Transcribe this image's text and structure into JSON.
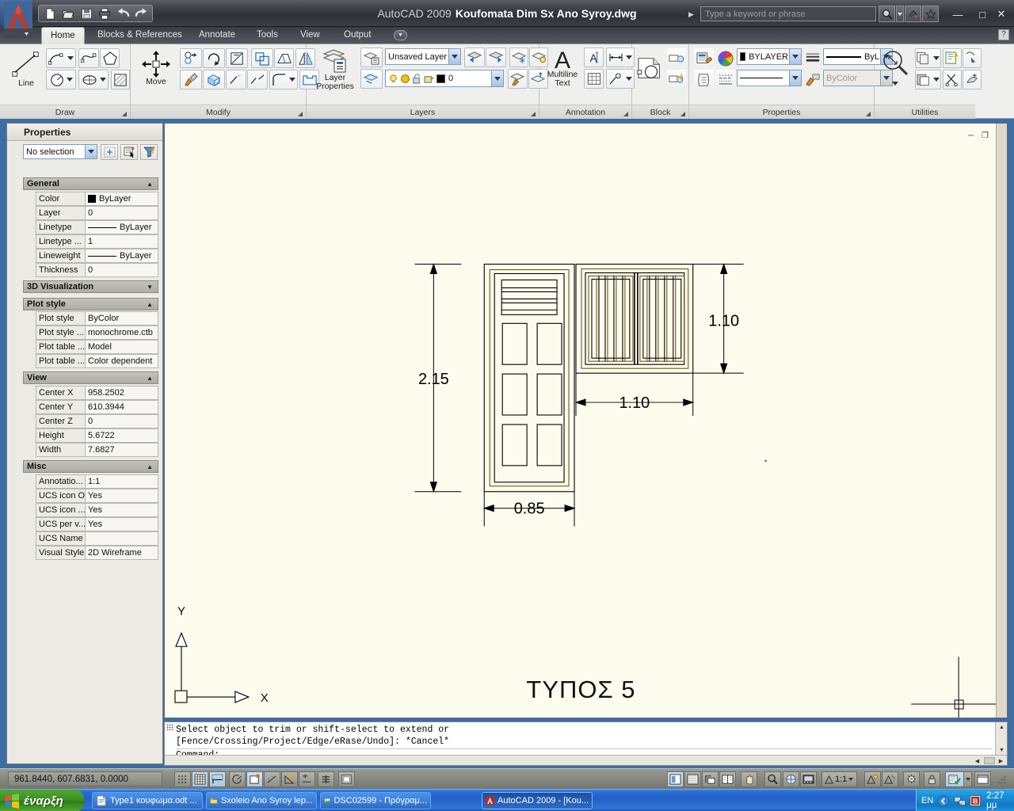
{
  "titlebar": {
    "app_name": "AutoCAD 2009",
    "document": "Koufomata Dim Sx Ano Syroy.dwg",
    "search_placeholder": "Type a keyword or phrase",
    "qat": [
      "new-icon",
      "open-icon",
      "save-icon",
      "plot-icon",
      "undo-icon",
      "redo-icon"
    ],
    "minimize": "—",
    "maximize": "□",
    "close": "✕",
    "help_label": "?"
  },
  "ribbon": {
    "tabs": [
      {
        "label": "Home",
        "active": true
      },
      {
        "label": "Blocks & References",
        "active": false
      },
      {
        "label": "Annotate",
        "active": false
      },
      {
        "label": "Tools",
        "active": false
      },
      {
        "label": "View",
        "active": false
      },
      {
        "label": "Output",
        "active": false
      }
    ],
    "panels": [
      {
        "label": "Draw",
        "big_button": "Line"
      },
      {
        "label": "Modify",
        "big_button": "Move"
      },
      {
        "label": "Layers",
        "big_button": "Layer\nProperties"
      },
      {
        "label": "Annotation",
        "big_button": "Multiline\nText"
      },
      {
        "label": "Block",
        "big_button": ""
      },
      {
        "label": "Properties",
        "big_button": ""
      },
      {
        "label": "Utilities",
        "big_button": ""
      }
    ],
    "layer_state": "Unsaved Layer S",
    "layer_current": "0",
    "prop_color": "BYLAYER",
    "prop_lineweight": "ByL",
    "prop_plotstyle": "ByColor"
  },
  "properties_palette": {
    "title": "Properties",
    "selection": "No selection",
    "groups": [
      {
        "name": "General",
        "expanded": true,
        "rows": [
          {
            "key": "Color",
            "value": "ByLayer",
            "swatch": true
          },
          {
            "key": "Layer",
            "value": "0"
          },
          {
            "key": "Linetype",
            "value": "ByLayer",
            "line": true
          },
          {
            "key": "Linetype ...",
            "value": "1"
          },
          {
            "key": "Lineweight",
            "value": "ByLayer",
            "line": true
          },
          {
            "key": "Thickness",
            "value": "0"
          }
        ]
      },
      {
        "name": "3D Visualization",
        "expanded": false,
        "rows": []
      },
      {
        "name": "Plot style",
        "expanded": true,
        "rows": [
          {
            "key": "Plot style",
            "value": "ByColor"
          },
          {
            "key": "Plot style ...",
            "value": "monochrome.ctb"
          },
          {
            "key": "Plot table ...",
            "value": "Model"
          },
          {
            "key": "Plot table ...",
            "value": "Color dependent"
          }
        ]
      },
      {
        "name": "View",
        "expanded": true,
        "rows": [
          {
            "key": "Center X",
            "value": "958.2502"
          },
          {
            "key": "Center Y",
            "value": "610.3944"
          },
          {
            "key": "Center Z",
            "value": "0"
          },
          {
            "key": "Height",
            "value": "5.6722"
          },
          {
            "key": "Width",
            "value": "7.6827"
          }
        ]
      },
      {
        "name": "Misc",
        "expanded": true,
        "rows": [
          {
            "key": "Annotatio...",
            "value": "1:1"
          },
          {
            "key": "UCS icon On",
            "value": "Yes"
          },
          {
            "key": "UCS icon ...",
            "value": "Yes"
          },
          {
            "key": "UCS per v...",
            "value": "Yes"
          },
          {
            "key": "UCS Name",
            "value": ""
          },
          {
            "key": "Visual Style",
            "value": "2D Wireframe"
          }
        ]
      }
    ]
  },
  "drawing": {
    "title_label": "ΤΥΠΟΣ 5",
    "dimensions": {
      "door_height": "2.15",
      "door_width": "0.85",
      "window_height": "1.10",
      "window_width": "1.10"
    },
    "ucs": {
      "x_label": "X",
      "y_label": "Y"
    },
    "background_color": "#fdfbee",
    "line_color": "#000000",
    "frame_color": "#6b5a10"
  },
  "command_line": {
    "line1": "Select object to trim or shift-select to extend or",
    "line2": "[Fence/Crossing/Project/Edge/eRase/Undo]: *Cancel*",
    "prompt": "Command:"
  },
  "status_bar": {
    "coordinates": "961.8440, 607.6831, 0.0000",
    "scale": "1:1",
    "toggles": [
      "snap-icon",
      "grid-icon",
      "ortho-icon",
      "polar-icon",
      "osnap-icon",
      "otrack-icon",
      "ducs-icon",
      "dyn-icon",
      "lineweight-icon",
      "model-space-icon"
    ],
    "right_tools": [
      "model-layout-icon",
      "quick-view-layouts-icon",
      "quick-view-drawings-icon",
      "pan-icon",
      "zoom-icon",
      "steeringwheel-icon",
      "showmotion-icon",
      "annotation-scale-icon",
      "annotation-visibility-icon",
      "autoscale-icon",
      "workspace-icon",
      "lock-icon",
      "status-tray-icon",
      "clean-screen-icon"
    ]
  },
  "taskbar": {
    "start_label": "έναρξη",
    "items": [
      {
        "label": "Type1 κουφωμα.odt ...",
        "icon": "document-icon",
        "active": false
      },
      {
        "label": "Sxoleio Ano Syroy lep...",
        "icon": "folder-icon",
        "active": false
      },
      {
        "label": "DSC02599 - Πρόγραμ...",
        "icon": "image-icon",
        "active": false
      },
      {
        "label": "AutoCAD 2009 - [Kou...",
        "icon": "autocad-icon",
        "active": true
      }
    ],
    "tray": {
      "language": "EN",
      "clock": "2:27 μμ",
      "icons": [
        "show-hidden-icon",
        "network-icon",
        "bitdefender-icon"
      ]
    }
  }
}
